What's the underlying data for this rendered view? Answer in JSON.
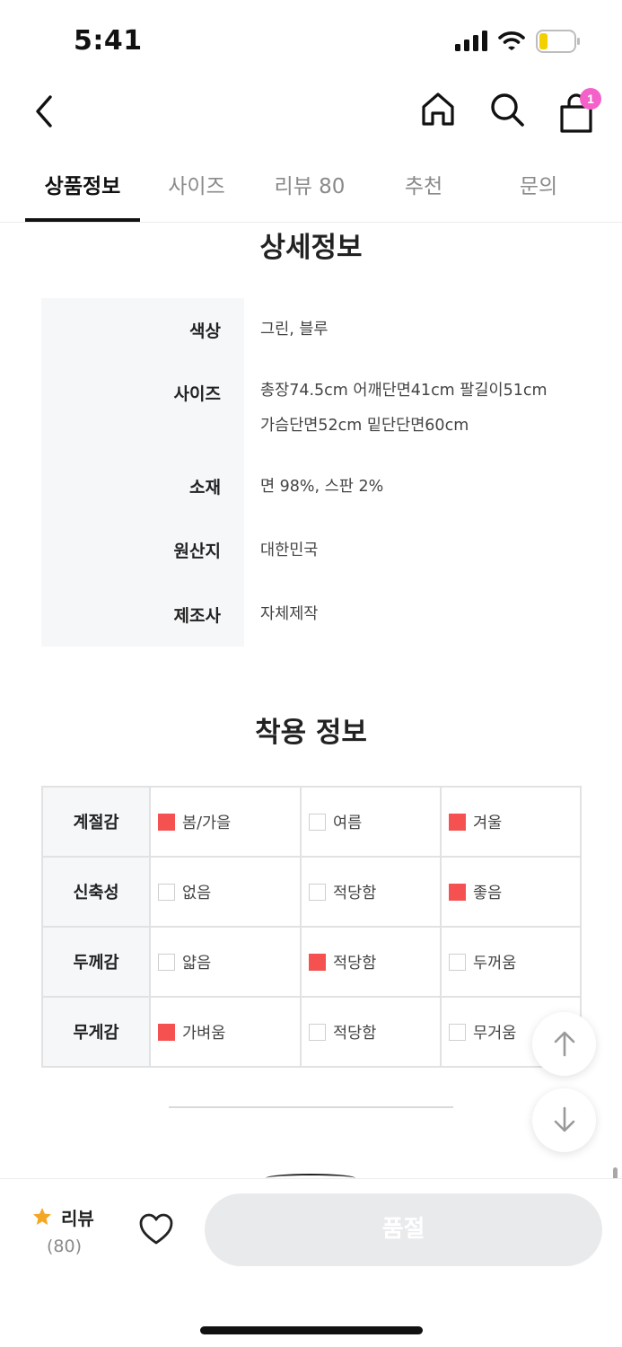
{
  "status": {
    "time": "5:41"
  },
  "header": {
    "cart_count": "1"
  },
  "tabs": [
    {
      "label": "상품정보"
    },
    {
      "label": "사이즈"
    },
    {
      "label": "리뷰 80"
    },
    {
      "label": "추천"
    },
    {
      "label": "문의"
    }
  ],
  "detail": {
    "title": "상세정보",
    "rows": [
      {
        "label": "색상",
        "value": "그린, 블루"
      },
      {
        "label": "사이즈",
        "value": "총장74.5cm 어깨단면41cm 팔길이51cm",
        "value2": "가슴단면52cm 밑단단면60cm"
      },
      {
        "label": "소재",
        "value": "면 98%, 스판 2%"
      },
      {
        "label": "원산지",
        "value": "대한민국"
      },
      {
        "label": "제조사",
        "value": "자체제작"
      }
    ]
  },
  "wear": {
    "title": "착용 정보",
    "rows": [
      {
        "label": "계절감",
        "options": [
          {
            "text": "봄/가을",
            "checked": true
          },
          {
            "text": "여름",
            "checked": false
          },
          {
            "text": "겨울",
            "checked": true
          }
        ]
      },
      {
        "label": "신축성",
        "options": [
          {
            "text": "없음",
            "checked": false
          },
          {
            "text": "적당함",
            "checked": false
          },
          {
            "text": "좋음",
            "checked": true
          }
        ]
      },
      {
        "label": "두께감",
        "options": [
          {
            "text": "얇음",
            "checked": false
          },
          {
            "text": "적당함",
            "checked": true
          },
          {
            "text": "두꺼움",
            "checked": false
          }
        ]
      },
      {
        "label": "무게감",
        "options": [
          {
            "text": "가벼움",
            "checked": true
          },
          {
            "text": "적당함",
            "checked": false
          },
          {
            "text": "무거움",
            "checked": false
          }
        ]
      }
    ]
  },
  "bottom": {
    "review_label": "리뷰",
    "review_count": "(80)",
    "buy_label": "품절"
  },
  "colors": {
    "accent": "#f55151",
    "badge": "#f361c9",
    "star": "#f5a623"
  }
}
